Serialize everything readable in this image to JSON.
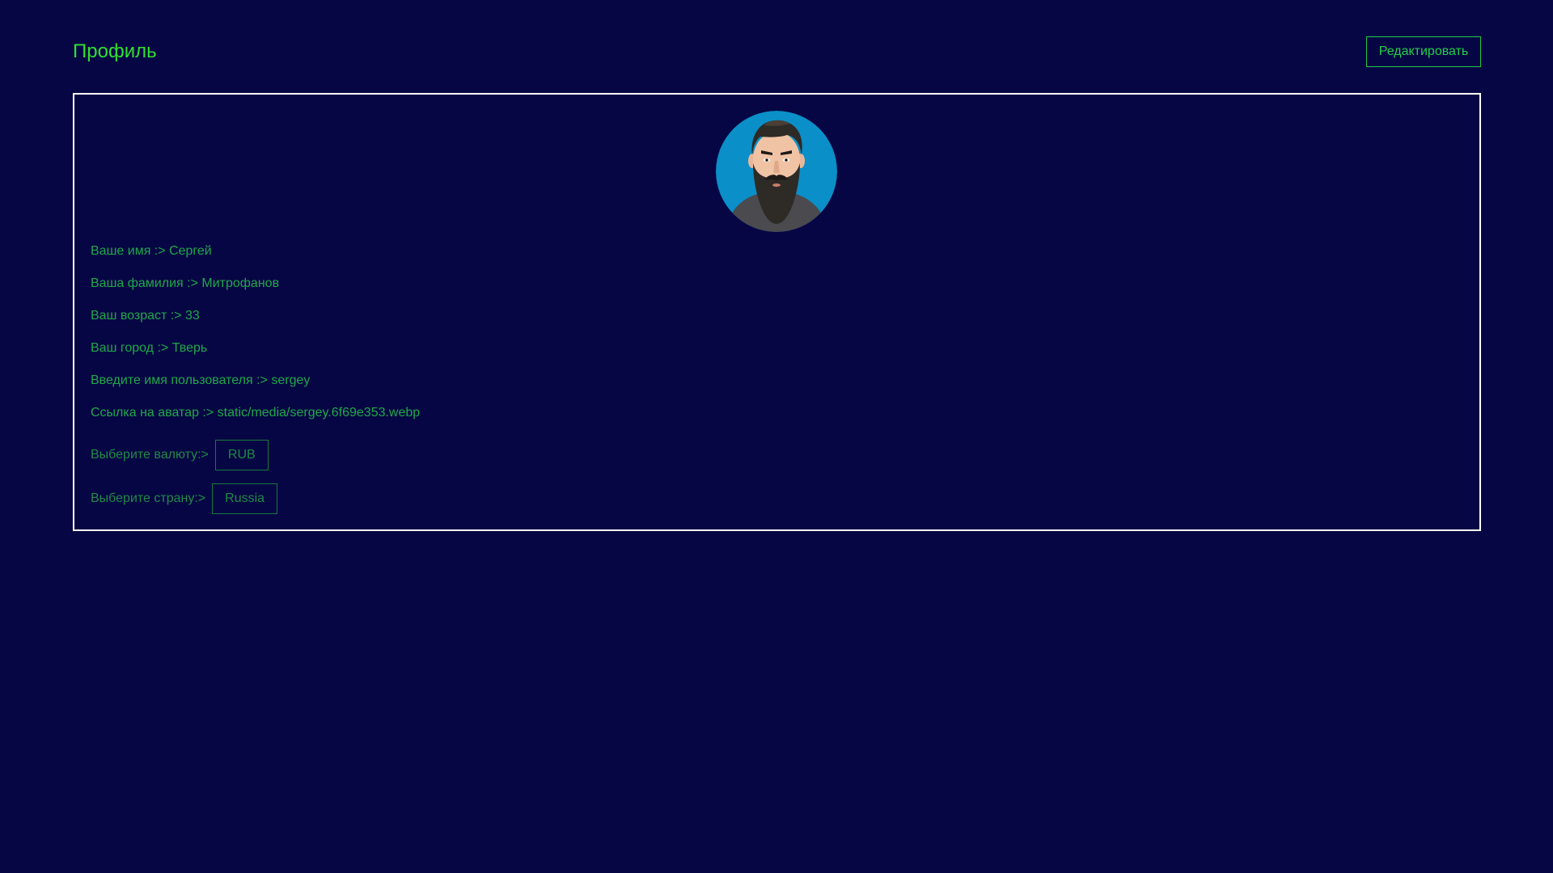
{
  "header": {
    "title": "Профиль",
    "edit_label": "Редактировать"
  },
  "profile": {
    "avatar_icon": "bearded-man-avatar",
    "fields": [
      {
        "label": "Ваше имя :> ",
        "value": "Сергей"
      },
      {
        "label": "Ваша фамилия :> ",
        "value": "Митрофанов"
      },
      {
        "label": "Ваш возраст :> ",
        "value": "33"
      },
      {
        "label": "Ваш город :> ",
        "value": "Тверь"
      },
      {
        "label": "Введите имя пользователя :> ",
        "value": "sergey"
      },
      {
        "label": "Ссылка на аватар :> ",
        "value": "static/media/sergey.6f69e353.webp"
      }
    ],
    "currency": {
      "label": "Выберите валюту:>",
      "selected": "RUB"
    },
    "country": {
      "label": "Выберите страну:>",
      "selected": "Russia"
    }
  },
  "colors": {
    "background": "#070644",
    "accent": "#2fe02f",
    "text": "#1fa84a",
    "card_border": "#ffffff"
  }
}
